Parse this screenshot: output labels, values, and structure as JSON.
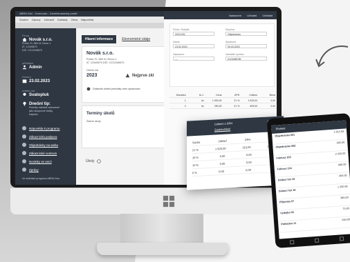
{
  "window_title": "ABRA Gen - Kormoran - Zaměstnanecký portál",
  "menu": [
    "Soubor",
    "Úpravy",
    "Zobrazit",
    "Doklady",
    "Okna",
    "Nápověda"
  ],
  "sidebar": {
    "firm_label": "Firma",
    "firm_name": "Novák s.r.o.",
    "firm_lines": [
      "Praha 70, 580 01 Zlínov 1",
      "IČ: 12345670",
      "DIČ: CZ12345670"
    ],
    "user_label": "přihlášen",
    "user_name": "Admin",
    "date_label": "Dnešní",
    "date_value": "23.02.2023",
    "holiday_label": "svátek má",
    "holiday_value": "Svatopluk",
    "tip_title": "Dnešní tip:",
    "tip_text": [
      "Položky nabídek zobrazené",
      "jako sloupcové balíky",
      "kdykoliv."
    ],
    "links": [
      "Nápověda k programu",
      "Zákaznická podpora",
      "Objednávky na webu",
      "Zákaznické centrum",
      "Novinky ve verzi",
      "Zprávy"
    ],
    "footer": "Ve službách programu ABRA Gen."
  },
  "content": {
    "tab_active": "Hlavní informace",
    "tab_other": "Ekonomické údaje",
    "company": "Novák s.r.o.",
    "company_lines": [
      "Praha 70, 580 01 Zlínov 1",
      "IČ: 12345670 DIČ: CZ12345670"
    ],
    "period_label": "Účetní rok",
    "period_value": "2023",
    "warn_label": "Nejprve zkl",
    "info_line": "Dotazník účetní jednotky není zpracován",
    "tasks_title": "Termíny úkolů",
    "tasks_empty": "Žádné úkoly",
    "bottom_label": "Úkoly"
  },
  "right_ui": {
    "topnav": [
      "Nastavení",
      "Uživatel",
      "Odhlásit"
    ],
    "form_labels": [
      "Firma / Subjekt",
      "Skupina",
      "Datum",
      "Splatnost",
      "Zaplaceno",
      "Variabilní symbol"
    ],
    "form_values": [
      "2023-001",
      "Objednávka",
      "23.02.2023",
      "09.03.2023",
      "—",
      "0123456789"
    ],
    "table_header": [
      "Množství",
      "M.J.",
      "Cena",
      "DPH",
      "Celkem",
      "Sleva"
    ],
    "table_rows": [
      [
        "1",
        "ks",
        "1 500,00",
        "21 %",
        "1 815,00",
        "0,00"
      ],
      [
        "2",
        "ks",
        "250,00",
        "21 %",
        "605,00",
        "0,00"
      ]
    ]
  },
  "panel": {
    "head_lines": [
      "Celkem s DPH",
      "Zaokrouhlení"
    ],
    "head_values": [
      "1 815,00",
      "0,00"
    ],
    "rows": [
      [
        "Sazba",
        "Základ",
        "DPH",
        "Celkem"
      ],
      [
        "21 %",
        "1 500,00",
        "315,00",
        "1 815,00"
      ],
      [
        "15 %",
        "0,00",
        "0,00",
        "0,00"
      ],
      [
        "10 %",
        "0,00",
        "0,00",
        "0,00"
      ],
      [
        "0 %",
        "0,00",
        "0,00",
        "0,00"
      ]
    ]
  },
  "tablet": {
    "title": "Přehled",
    "items": [
      {
        "name": "Objednávka 001",
        "value": "1 815,00"
      },
      {
        "name": "Objednávka 002",
        "value": "605,00"
      },
      {
        "name": "Faktura 103",
        "value": "2 420,00"
      },
      {
        "name": "Faktura 104",
        "value": "990,00"
      },
      {
        "name": "Dodací list 15",
        "value": "450,00"
      },
      {
        "name": "Dodací list 16",
        "value": "1 200,00"
      },
      {
        "name": "Příjemka 07",
        "value": "380,00"
      },
      {
        "name": "Výdejka 02",
        "value": "75,00"
      },
      {
        "name": "Pokladna 11",
        "value": "640,00"
      }
    ]
  }
}
